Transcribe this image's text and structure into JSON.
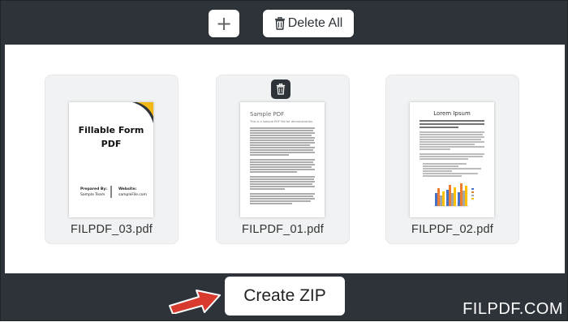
{
  "toolbar": {
    "add_icon": "plus-icon",
    "delete_all_label": "Delete All",
    "delete_icon": "trash-icon"
  },
  "files": [
    {
      "name": "FILPDF_03.pdf",
      "thumb_title": "Fillable Form PDF",
      "thumb_prepared_label": "Prepared By:",
      "thumb_prepared_value": "Sample Team",
      "thumb_website_label": "Website:",
      "thumb_website_value": "sampleFile.com"
    },
    {
      "name": "FILPDF_01.pdf",
      "thumb_title": "Sample PDF",
      "thumb_subtitle": "This is a sample PDF file for demonstration."
    },
    {
      "name": "FILPDF_02.pdf",
      "thumb_title": "Lorem Ipsum",
      "thumb_subtitle": "Lorem ipsum dolor sit amet, consectetur adipiscing elit. Nunc ac faucibus odio."
    }
  ],
  "footer": {
    "create_zip_label": "Create ZIP",
    "brand": "FILPDF.COM"
  },
  "colors": {
    "frame": "#2d3339",
    "arrow": "#d83a2e",
    "chart_blue": "#4472c4",
    "chart_orange": "#ed7d31",
    "chart_gray": "#a5a5a5",
    "chart_yellow": "#ffc000"
  }
}
